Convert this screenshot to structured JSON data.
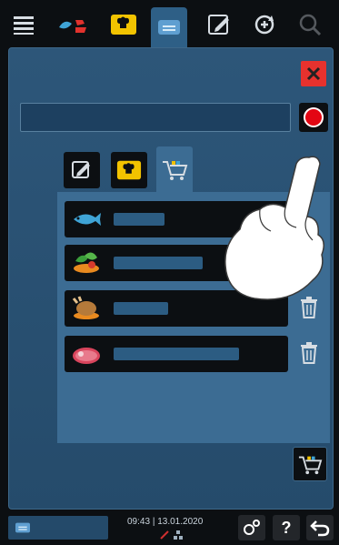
{
  "topbar": {
    "icons": [
      "menu-icon",
      "fish-meat-icon",
      "chef-hat-icon",
      "tray-icon",
      "edit-icon",
      "refresh-icon",
      "search-icon"
    ]
  },
  "panel": {
    "name_placeholder": "",
    "tabs": [
      {
        "name": "edit-icon"
      },
      {
        "name": "chef-hat-icon"
      },
      {
        "name": "cart-icon",
        "active": true
      }
    ],
    "rows": [
      {
        "icon": "fish-icon",
        "label": ""
      },
      {
        "icon": "vegetables-icon",
        "label": ""
      },
      {
        "icon": "poultry-icon",
        "label": ""
      },
      {
        "icon": "meat-icon",
        "label": ""
      }
    ]
  },
  "statusbar": {
    "time": "09:43",
    "separator": "|",
    "date": "13.01.2020",
    "help_label": "?"
  },
  "colors": {
    "accent_blue": "#2e5f86",
    "close_red": "#e7322e",
    "record_red": "#e30613",
    "yellow": "#f2c300"
  }
}
